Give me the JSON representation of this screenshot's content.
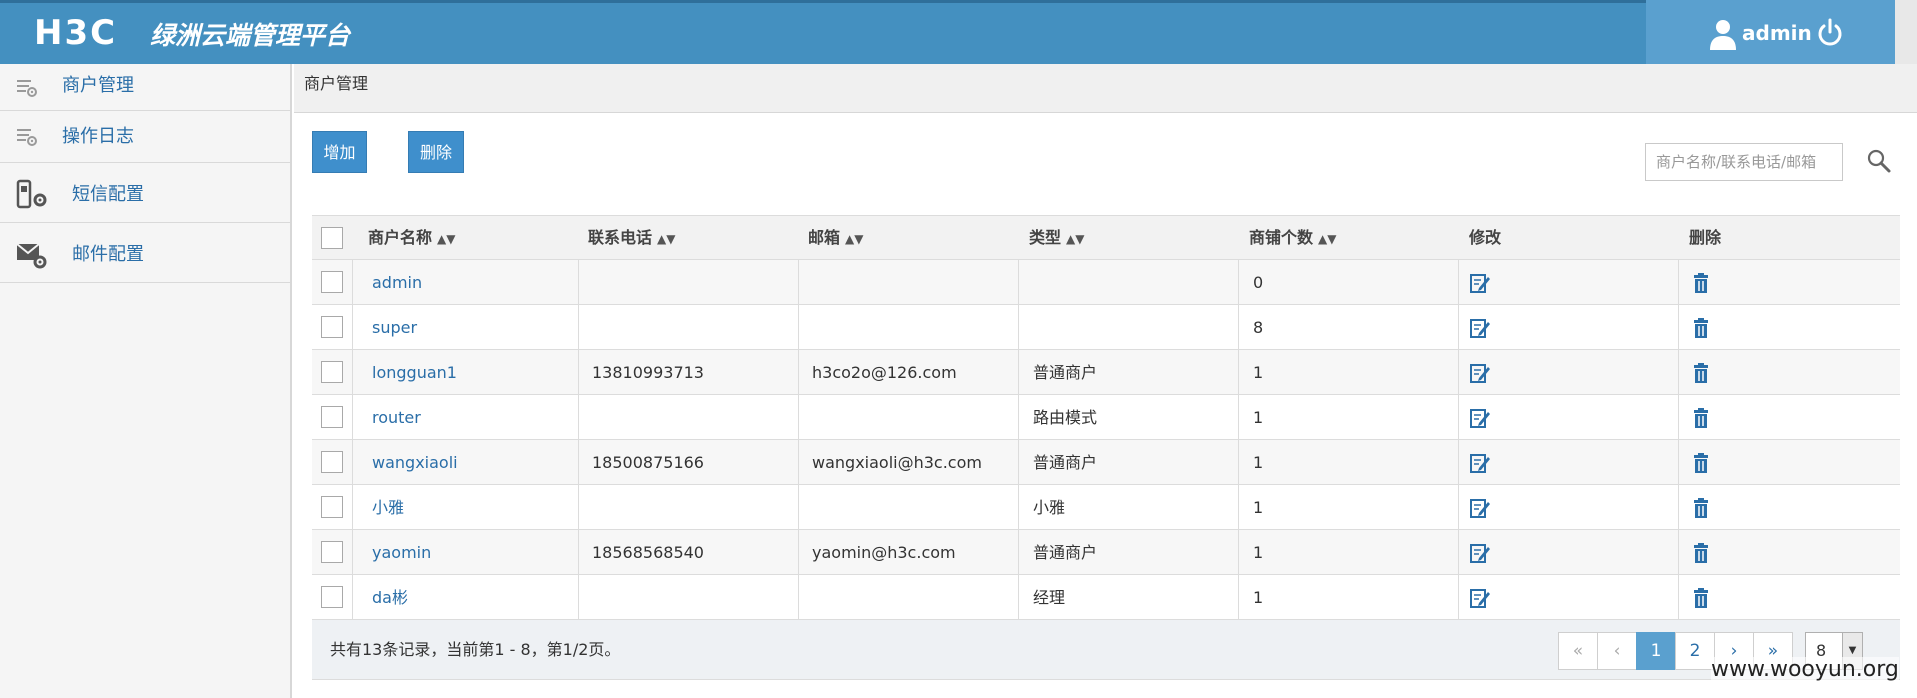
{
  "header": {
    "logo": "H3C",
    "app_title": "绿洲云端管理平台",
    "user": "admin",
    "colors": {
      "header_bg": "#4490c0",
      "user_box_bg": "#5aa0cf"
    }
  },
  "sidebar": {
    "items": [
      {
        "label": "商户管理",
        "icon": "list-gear-icon"
      },
      {
        "label": "操作日志",
        "icon": "list-gear-icon"
      },
      {
        "label": "短信配置",
        "icon": "phone-gear-icon"
      },
      {
        "label": "邮件配置",
        "icon": "mail-gear-icon"
      }
    ]
  },
  "breadcrumb": "商户管理",
  "toolbar": {
    "add_label": "增加",
    "delete_label": "删除",
    "search_placeholder": "商户名称/联系电话/邮箱",
    "search_icon": "search-icon"
  },
  "table": {
    "columns": [
      "商户名称",
      "联系电话",
      "邮箱",
      "类型",
      "商铺个数",
      "修改",
      "删除"
    ],
    "sortable": [
      true,
      true,
      true,
      true,
      true,
      false,
      false
    ],
    "rows": [
      {
        "name": "admin",
        "phone": "",
        "email": "",
        "type": "",
        "shops": "0"
      },
      {
        "name": "super",
        "phone": "",
        "email": "",
        "type": "",
        "shops": "8"
      },
      {
        "name": "longguan1",
        "phone": "13810993713",
        "email": "h3co2o@126.com",
        "type": "普通商户",
        "shops": "1"
      },
      {
        "name": "router",
        "phone": "",
        "email": "",
        "type": "路由模式",
        "shops": "1"
      },
      {
        "name": "wangxiaoli",
        "phone": "18500875166",
        "email": "wangxiaoli@h3c.com",
        "type": "普通商户",
        "shops": "1"
      },
      {
        "name": "小雅",
        "phone": "",
        "email": "",
        "type": "小雅",
        "shops": "1"
      },
      {
        "name": "yaomin",
        "phone": "18568568540",
        "email": "yaomin@h3c.com",
        "type": "普通商户",
        "shops": "1"
      },
      {
        "name": "da彬",
        "phone": "",
        "email": "",
        "type": "经理",
        "shops": "1"
      }
    ],
    "edit_icon": "edit-icon",
    "delete_icon": "trash-icon"
  },
  "footer": {
    "summary": "共有13条记录，当前第1 - 8，第1/2页。",
    "pager": [
      "«",
      "‹",
      "1",
      "2",
      "›",
      "»"
    ],
    "current_page": "1",
    "page_size": "8"
  },
  "watermark": "www.wooyun.org"
}
